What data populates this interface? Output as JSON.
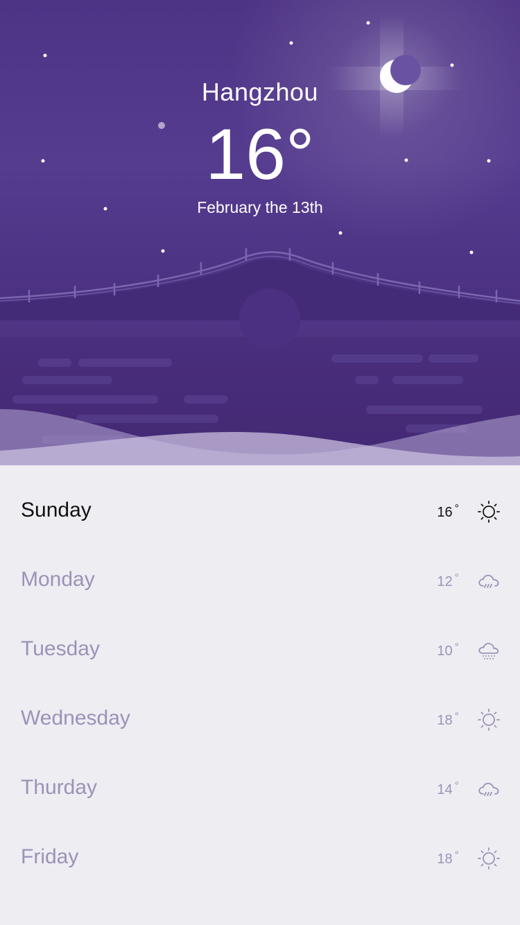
{
  "header": {
    "city": "Hangzhou",
    "temperature": "16°",
    "date": "February the 13th"
  },
  "colors": {
    "sky": "#4e3485",
    "list_bg": "#eeedf2",
    "active_text": "#111111",
    "inactive_text": "#9c92b8"
  },
  "forecast": [
    {
      "day": "Sunday",
      "temp": "16",
      "deg": "°",
      "icon": "sun-icon"
    },
    {
      "day": "Monday",
      "temp": "12",
      "deg": "°",
      "icon": "rain-cloud-icon"
    },
    {
      "day": "Tuesday",
      "temp": "10",
      "deg": "°",
      "icon": "snow-cloud-icon"
    },
    {
      "day": "Wednesday",
      "temp": "18",
      "deg": "°",
      "icon": "sun-icon"
    },
    {
      "day": "Thurday",
      "temp": "14",
      "deg": "°",
      "icon": "rain-cloud-icon"
    },
    {
      "day": "Friday",
      "temp": "18",
      "deg": "°",
      "icon": "sun-icon"
    }
  ]
}
